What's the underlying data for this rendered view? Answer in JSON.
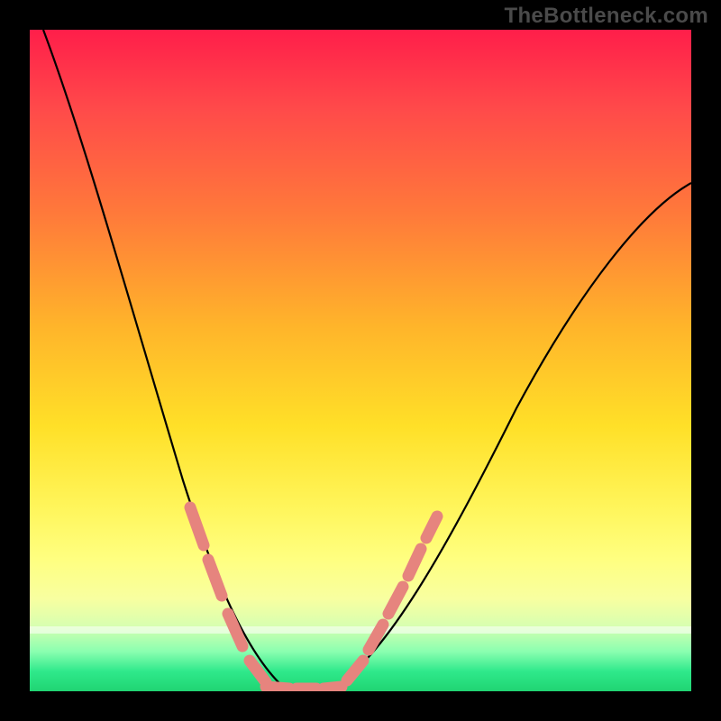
{
  "watermark": "TheBottleneck.com",
  "colors": {
    "background": "#000000",
    "gradient_top": "#ff1e4a",
    "gradient_bottom": "#20d472",
    "curve": "#000000",
    "markers": "#e6847e"
  },
  "chart_data": {
    "type": "line",
    "title": "",
    "xlabel": "",
    "ylabel": "",
    "xlim": [
      0,
      100
    ],
    "ylim": [
      0,
      100
    ],
    "x": [
      0,
      2,
      5,
      8,
      12,
      16,
      20,
      24,
      27,
      30,
      33,
      35,
      38,
      40,
      43,
      46,
      50,
      55,
      60,
      65,
      70,
      75,
      80,
      85,
      90,
      95,
      100
    ],
    "y": [
      100,
      94,
      84,
      74,
      61,
      49,
      38,
      27,
      18,
      11,
      5,
      2,
      0,
      0,
      0,
      1,
      5,
      12,
      21,
      30,
      38,
      46,
      53,
      60,
      66,
      71,
      76
    ],
    "annotations": {
      "marker_segments_left": [
        {
          "x0": 24,
          "y0": 27,
          "x1": 26,
          "y1": 21
        },
        {
          "x0": 27,
          "y0": 18,
          "x1": 29,
          "y1": 12
        },
        {
          "x0": 30,
          "y0": 10,
          "x1": 32,
          "y1": 6
        },
        {
          "x0": 33,
          "y0": 4,
          "x1": 35,
          "y1": 1
        }
      ],
      "marker_segments_bottom": [
        {
          "x0": 35,
          "y0": 0,
          "x1": 38,
          "y1": 0
        },
        {
          "x0": 39,
          "y0": 0,
          "x1": 42,
          "y1": 0
        },
        {
          "x0": 43,
          "y0": 0,
          "x1": 46,
          "y1": 0
        }
      ],
      "marker_segments_right": [
        {
          "x0": 47,
          "y0": 2,
          "x1": 49,
          "y1": 5
        },
        {
          "x0": 50,
          "y0": 7,
          "x1": 52,
          "y1": 11
        },
        {
          "x0": 53,
          "y0": 13,
          "x1": 55,
          "y1": 17
        },
        {
          "x0": 56,
          "y0": 19,
          "x1": 58,
          "y1": 23
        },
        {
          "x0": 59,
          "y0": 25,
          "x1": 60,
          "y1": 27
        }
      ]
    }
  }
}
